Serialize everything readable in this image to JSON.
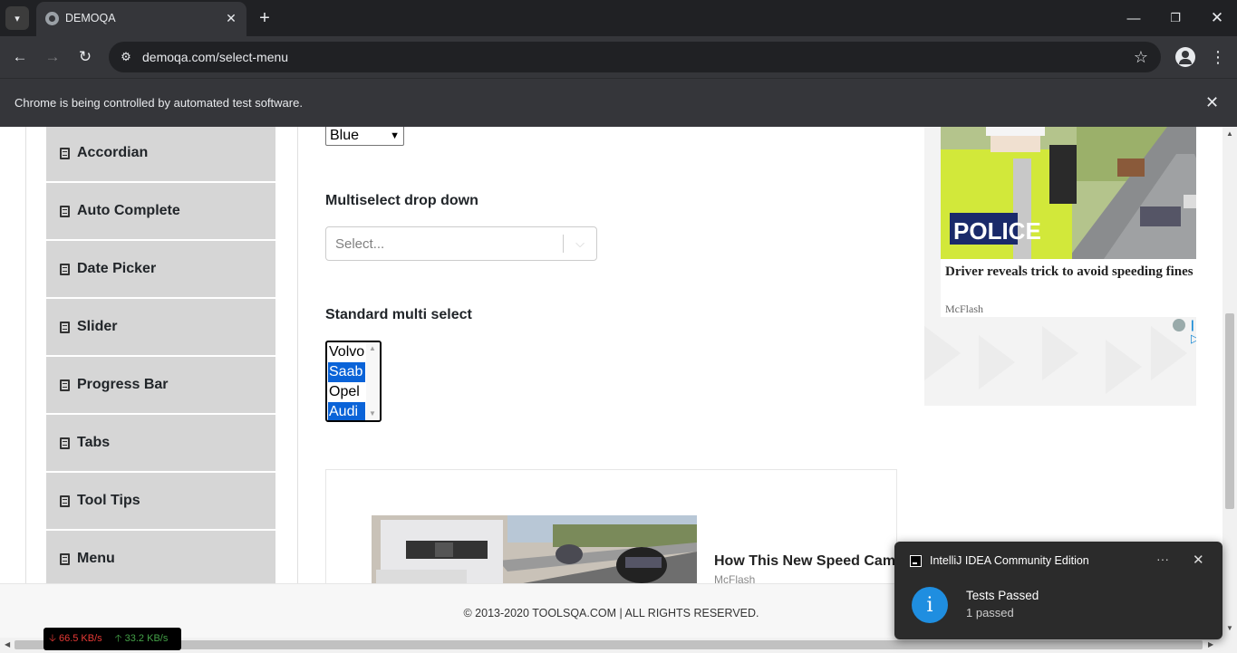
{
  "browser": {
    "tab_title": "DEMOQA",
    "url": "demoqa.com/select-menu",
    "infobar_text": "Chrome is being controlled by automated test software."
  },
  "icons": {
    "tab_search": "chevron-down-icon",
    "favicon": "globe-icon",
    "tab_close": "close-icon",
    "new_tab": "plus-icon",
    "back": "arrow-left-icon",
    "forward": "arrow-right-icon",
    "reload": "reload-icon",
    "site_info": "tune-icon",
    "bookmark": "star-icon",
    "profile": "person-icon",
    "menu": "kebab-icon"
  },
  "sidebar": {
    "items": [
      {
        "label": "Accordian"
      },
      {
        "label": "Auto Complete"
      },
      {
        "label": "Date Picker"
      },
      {
        "label": "Slider"
      },
      {
        "label": "Progress Bar"
      },
      {
        "label": "Tabs"
      },
      {
        "label": "Tool Tips"
      },
      {
        "label": "Menu"
      }
    ]
  },
  "main": {
    "old_select_value": "Blue",
    "multiselect_label": "Multiselect drop down",
    "multiselect_placeholder": "Select...",
    "standard_label": "Standard multi select",
    "standard_options": [
      {
        "label": "Volvo",
        "selected": false
      },
      {
        "label": "Saab",
        "selected": true
      },
      {
        "label": "Opel",
        "selected": false
      },
      {
        "label": "Audi",
        "selected": true
      }
    ]
  },
  "ads": {
    "right": {
      "title": "Driver reveals trick to avoid speeding fines",
      "source": "McFlash"
    },
    "bottom": {
      "title": "How This New Speed Cam",
      "source": "McFlash"
    }
  },
  "footer": {
    "text": "© 2013-2020 TOOLSQA.COM | ALL RIGHTS RESERVED."
  },
  "netspeed": {
    "down": "66.5 KB/s",
    "up": "33.2 KB/s"
  },
  "toast": {
    "app": "IntelliJ IDEA Community Edition",
    "title": "Tests Passed",
    "subtitle": "1 passed"
  },
  "colors": {
    "chrome_dark": "#202124",
    "chrome_toolbar": "#35363a",
    "sidebar_item": "#d6d6d6",
    "selected_option": "#0a63d8",
    "toast_bg": "#2b2b2b",
    "info_blue": "#1f8ee0"
  }
}
